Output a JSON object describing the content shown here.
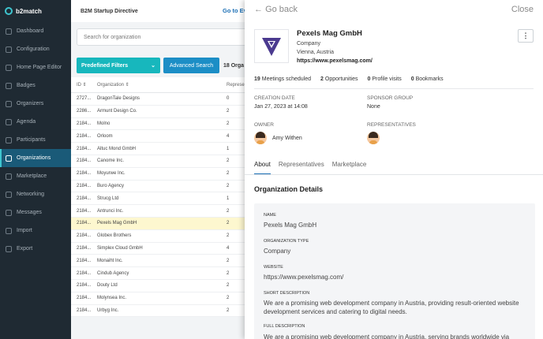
{
  "sidebar": {
    "logo": "b2match",
    "items": [
      {
        "label": "Dashboard",
        "active": false
      },
      {
        "label": "Configuration",
        "active": false
      },
      {
        "label": "Home Page Editor",
        "active": false
      },
      {
        "label": "Badges",
        "active": false
      },
      {
        "label": "Organizers",
        "active": false
      },
      {
        "label": "Agenda",
        "active": false
      },
      {
        "label": "Participants",
        "active": false
      },
      {
        "label": "Organizations",
        "active": true
      },
      {
        "label": "Marketplace",
        "active": false
      },
      {
        "label": "Networking",
        "active": false
      },
      {
        "label": "Messages",
        "active": false
      },
      {
        "label": "Import",
        "active": false
      },
      {
        "label": "Export",
        "active": false
      }
    ]
  },
  "header": {
    "event_title": "B2M Startup Directive",
    "goto_link": "Go to Ev"
  },
  "search": {
    "placeholder": "Search for organization"
  },
  "filters": {
    "predefined_label": "Predefined Filters",
    "advanced_label": "Advanced Search",
    "count": "18 Orga"
  },
  "table": {
    "headers": {
      "id": "ID",
      "org": "Organization",
      "x": "Represe"
    },
    "rows": [
      {
        "id": "2727...",
        "org": "DragonTale Designs",
        "x": "0"
      },
      {
        "id": "2286...",
        "org": "Armunt Design Co.",
        "x": "2"
      },
      {
        "id": "2184...",
        "org": "Molno",
        "x": "2"
      },
      {
        "id": "2184...",
        "org": "Orloom",
        "x": "4"
      },
      {
        "id": "2184...",
        "org": "Altuc Mond GmbH",
        "x": "1"
      },
      {
        "id": "2184...",
        "org": "Canome Inc.",
        "x": "2"
      },
      {
        "id": "2184...",
        "org": "Moyurwe Inc.",
        "x": "2"
      },
      {
        "id": "2184...",
        "org": "Buro Agency",
        "x": "2"
      },
      {
        "id": "2184...",
        "org": "Strucg Ltd",
        "x": "1"
      },
      {
        "id": "2184...",
        "org": "Antrunci Inc.",
        "x": "2"
      },
      {
        "id": "2184...",
        "org": "Pexels Mag GmbH",
        "x": "2",
        "highlight": true
      },
      {
        "id": "2184...",
        "org": "Globex Brothers",
        "x": "2"
      },
      {
        "id": "2184...",
        "org": "Simplex Cloud GmbH",
        "x": "4"
      },
      {
        "id": "2184...",
        "org": "Monaiht Inc.",
        "x": "2"
      },
      {
        "id": "2184...",
        "org": "Cindub Agency",
        "x": "2"
      },
      {
        "id": "2184...",
        "org": "Douty Ltd",
        "x": "2"
      },
      {
        "id": "2184...",
        "org": "Molynsea Inc.",
        "x": "2"
      },
      {
        "id": "2184...",
        "org": "Urbyg Inc.",
        "x": "2"
      }
    ]
  },
  "panel": {
    "back_label": "Go back",
    "close_label": "Close",
    "name": "Pexels Mag GmbH",
    "type": "Company",
    "location": "Vienna, Austria",
    "url": "https://www.pexelsmag.com/",
    "stats": {
      "meetings": "19",
      "meetings_label": "Meetings scheduled",
      "opportunities": "2",
      "opportunities_label": "Opportunities",
      "visits": "0",
      "visits_label": "Profile visits",
      "bookmarks": "0",
      "bookmarks_label": "Bookmarks"
    },
    "creation_date_label": "Creation Date",
    "creation_date": "Jan 27, 2023 at 14:08",
    "sponsor_group_label": "Sponsor Group",
    "sponsor_group": "None",
    "owner_label": "Owner",
    "owner_name": "Amy Withen",
    "representatives_label": "Representatives",
    "tabs": [
      "About",
      "Representatives",
      "Marketplace"
    ],
    "section_title": "Organization Details",
    "details": {
      "name_label": "Name",
      "name": "Pexels Mag GmbH",
      "type_label": "Organization Type",
      "type": "Company",
      "website_label": "Website",
      "website": "https://www.pexelsmag.com/",
      "short_label": "Short Description",
      "short": "We are a promising web development company in Austria, providing result-oriented website development services and catering to digital needs.",
      "full_label": "Full Description",
      "full": "We are a promising web development company in Austria, serving brands worldwide via"
    }
  },
  "colors": {
    "accent": "#17b7bd",
    "sidebar_bg": "#1f2a33",
    "active_bg": "#1a5a78",
    "highlight_row": "#fdf7cf",
    "logo_purple": "#4b3a8f"
  }
}
